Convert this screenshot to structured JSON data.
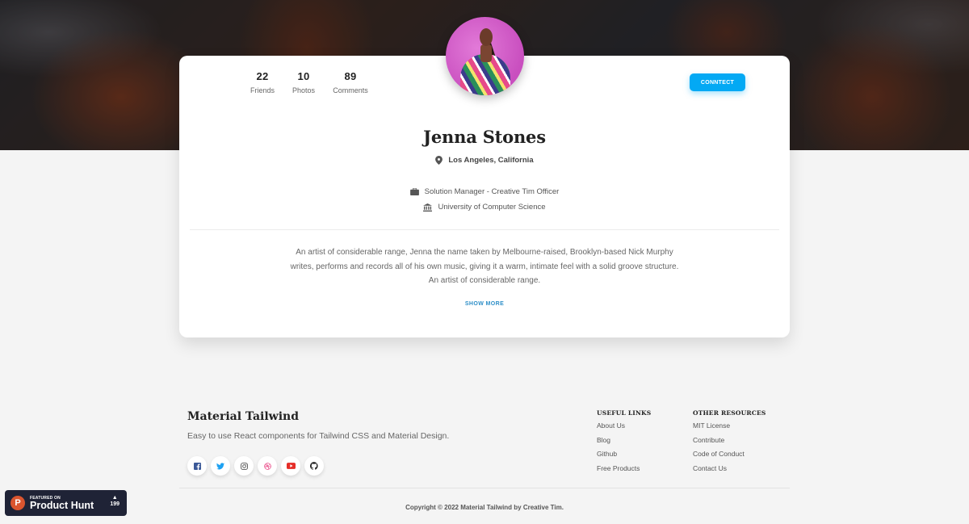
{
  "profile": {
    "stats": [
      {
        "value": "22",
        "label": "Friends"
      },
      {
        "value": "10",
        "label": "Photos"
      },
      {
        "value": "89",
        "label": "Comments"
      }
    ],
    "connect_label": "CONNTECT",
    "name": "Jenna Stones",
    "location": "Los Angeles, California",
    "job": "Solution Manager - Creative Tim Officer",
    "education": "University of Computer Science",
    "bio": [
      "An artist of considerable range, Jenna the name taken by Melbourne-raised, Brooklyn-based Nick Murphy",
      "writes, performs and records all of his own music, giving it a warm, intimate feel with a solid groove structure.",
      "An artist of considerable range."
    ],
    "show_more_label": "SHOW MORE",
    "accent_color": "#03a9f4"
  },
  "footer": {
    "brand": "Material Tailwind",
    "tagline": "Easy to use React components for Tailwind CSS and Material Design.",
    "socials": [
      {
        "icon": "facebook-icon",
        "color": "#3b5998"
      },
      {
        "icon": "twitter-icon",
        "color": "#1da1f2"
      },
      {
        "icon": "instagram-icon",
        "color": "#555555"
      },
      {
        "icon": "dribbble-icon",
        "color": "#ea4c89"
      },
      {
        "icon": "youtube-icon",
        "color": "#e52d27"
      },
      {
        "icon": "github-icon",
        "color": "#222222"
      }
    ],
    "useful_links": {
      "title": "USEFUL LINKS",
      "items": [
        "About Us",
        "Blog",
        "Github",
        "Free Products"
      ]
    },
    "other_resources": {
      "title": "OTHER RESOURCES",
      "items": [
        "MIT License",
        "Contribute",
        "Code of Conduct",
        "Contact Us"
      ]
    },
    "copyright": "Copyright © 2022 Material Tailwind by Creative Tim."
  },
  "product_hunt": {
    "small_label": "FEATURED ON",
    "big_label": "Product Hunt",
    "logo_letter": "P",
    "upvote_icon": "▲",
    "votes": "199"
  }
}
